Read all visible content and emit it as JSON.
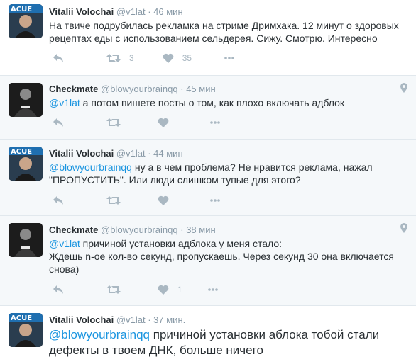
{
  "colors": {
    "text": "#292f33",
    "muted": "#8899a6",
    "link": "#1b95e0",
    "icon": "#aab8c2",
    "alt_background": "#f5f8fa"
  },
  "icons": [
    "reply-icon",
    "retweet-icon",
    "like-icon",
    "more-icon",
    "location-pin-icon"
  ],
  "tweets": [
    {
      "name": "Vitalii Volochai",
      "handle": "@v1lat",
      "sep": "·",
      "time": "46 мин",
      "mention": "",
      "text": "На твиче подрубилась рекламка на стриме Дримхака. 12 минут о здоровых рецептах еды с использованием сельдерея. Сижу. Смотрю. Интересно",
      "retweets": "3",
      "likes": "35"
    },
    {
      "name": "Checkmate",
      "handle": "@blowyourbrainqq",
      "sep": "·",
      "time": "45 мин",
      "mention": "@v1lat",
      "text": " а потом пишете посты о том, как плохо включать адблок",
      "retweets": "",
      "likes": ""
    },
    {
      "name": "Vitalii Volochai",
      "handle": "@v1lat",
      "sep": "·",
      "time": "44 мин",
      "mention": "@blowyourbrainqq",
      "text": " ну а в чем проблема? Не нравится реклама, нажал \"ПРОПУСТИТЬ\". Или люди слишком тупые для этого?",
      "retweets": "",
      "likes": ""
    },
    {
      "name": "Checkmate",
      "handle": "@blowyourbrainqq",
      "sep": "·",
      "time": "38 мин",
      "mention": "@v1lat",
      "text": " причиной установки адблока у меня стало:\nЖдешь n-ое кол-во секунд, пропускаешь. Через секунд 30 она включается снова)",
      "retweets": "",
      "likes": "1"
    },
    {
      "name": "Vitalii Volochai",
      "handle": "@v1lat",
      "sep": "·",
      "time": "37 мин.",
      "mention": "@blowyourbrainqq",
      "text": " причиной установки аблока тобой стали дефекты в твоем ДНК, больше ничего",
      "retweets": "",
      "likes": ""
    }
  ]
}
